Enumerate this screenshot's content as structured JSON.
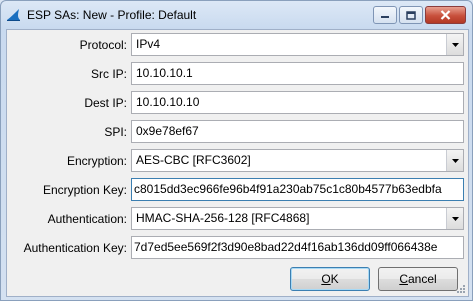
{
  "window": {
    "title": "ESP SAs: New - Profile: Default",
    "app_icon": "wireshark-fin-icon",
    "controls": [
      "minimize-icon",
      "maximize-icon",
      "close-icon"
    ]
  },
  "form": {
    "protocol": {
      "label": "Protocol:",
      "value": "IPv4"
    },
    "src_ip": {
      "label": "Src IP:",
      "value": "10.10.10.1"
    },
    "dest_ip": {
      "label": "Dest IP:",
      "value": "10.10.10.10"
    },
    "spi": {
      "label": "SPI:",
      "value": "0x9e78ef67"
    },
    "encryption": {
      "label": "Encryption:",
      "value": "AES-CBC [RFC3602]"
    },
    "encryption_key": {
      "label": "Encryption Key:",
      "value": "c8015dd3ec966fe96b4f91a230ab75c1c80b4577b63edbfa"
    },
    "authentication": {
      "label": "Authentication:",
      "value": "HMAC-SHA-256-128 [RFC4868]"
    },
    "authentication_key": {
      "label": "Authentication Key:",
      "value": "7d7ed5ee569f2f3d90e8bad22d4f16ab136dd09ff066438e"
    }
  },
  "buttons": {
    "ok_accel": "O",
    "ok_rest": "K",
    "cancel_accel": "C",
    "cancel_rest": "ancel"
  },
  "colors": {
    "close_button": "#c8503c",
    "default_button_border": "#3c7fb1"
  }
}
